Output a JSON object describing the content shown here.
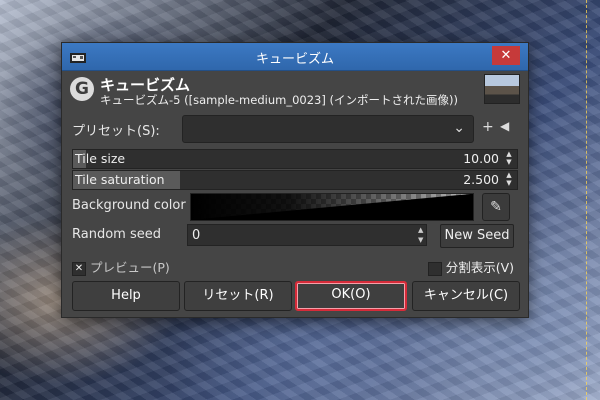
{
  "dialog": {
    "window_title": "キュービズム",
    "header_title": "キュービズム",
    "header_subtitle": "キュービズム-5 ([sample-medium_0023] (インポートされた画像))",
    "close_glyph": "✕"
  },
  "presets": {
    "label": "プリセット(S):",
    "value": ""
  },
  "params": {
    "tile_size": {
      "label": "Tile size",
      "value": "10.00",
      "fill_fraction": 0.03
    },
    "tile_saturation": {
      "label": "Tile saturation",
      "value": "2.500",
      "fill_fraction": 0.24
    }
  },
  "background_color": {
    "label": "Background color"
  },
  "random_seed": {
    "label": "Random seed",
    "value": "0",
    "new_seed_label": "New Seed"
  },
  "preview": {
    "label": "プレビュー(P)",
    "checked": true
  },
  "split_view": {
    "label": "分割表示(V)",
    "checked": false
  },
  "buttons": {
    "help": "Help",
    "reset": "リセット(R)",
    "ok": "OK(O)",
    "cancel": "キャンセル(C)"
  },
  "icons": {
    "app": "gimp-icon",
    "logo": "gimp-logo-icon",
    "add": "plus-icon",
    "menu": "preset-menu-icon",
    "picker": "color-picker-icon",
    "chevron": "chevron-down-icon"
  }
}
